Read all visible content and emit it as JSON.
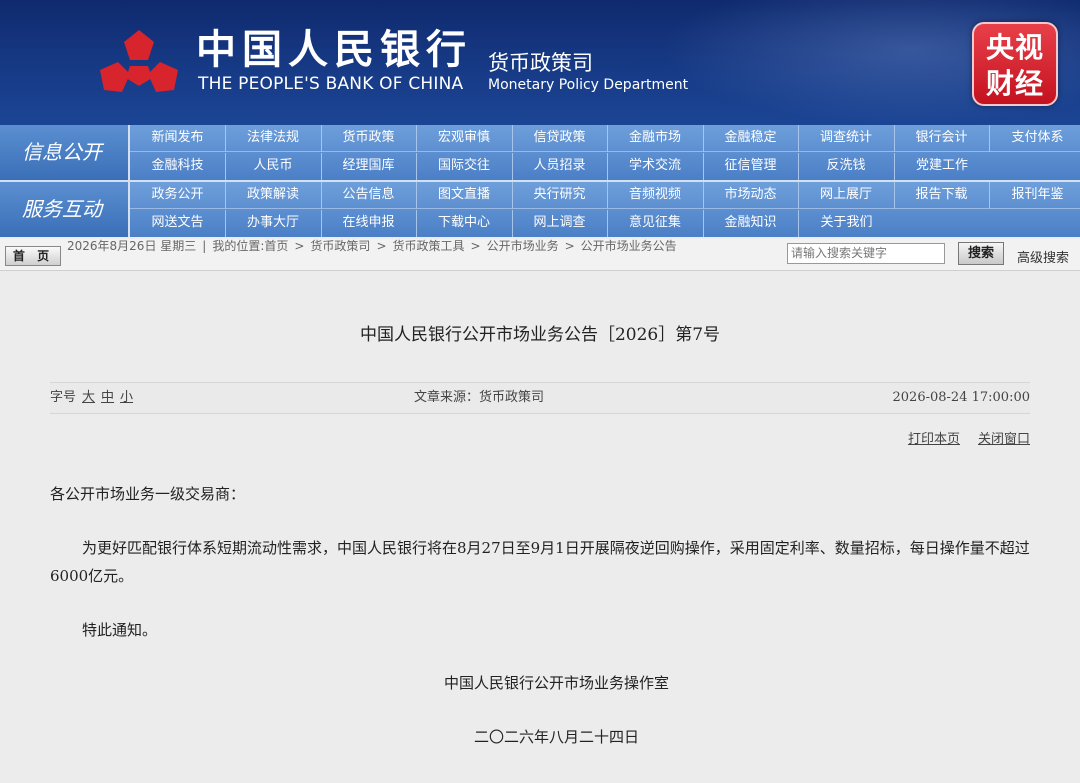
{
  "header": {
    "bank_name_cn": "中国人民银行",
    "bank_name_en": "THE PEOPLE'S BANK OF CHINA",
    "dept_cn": "货币政策司",
    "dept_en": "Monetary Policy Department",
    "logo_icon": "pboc-logo-icon",
    "watermark_line1": "央视",
    "watermark_line2": "财经",
    "colors": {
      "banner": "#173a86",
      "watermark": "#d81e2a"
    }
  },
  "nav": {
    "section1_title": "信息公开",
    "section1_row1": [
      "新闻发布",
      "法律法规",
      "货币政策",
      "宏观审慎",
      "信贷政策",
      "金融市场",
      "金融稳定",
      "调查统计",
      "银行会计",
      "支付体系"
    ],
    "section1_row2": [
      "金融科技",
      "人民币",
      "经理国库",
      "国际交往",
      "人员招录",
      "学术交流",
      "征信管理",
      "反洗钱",
      "党建工作"
    ],
    "section2_title": "服务互动",
    "section2_row1": [
      "政务公开",
      "政策解读",
      "公告信息",
      "图文直播",
      "央行研究",
      "音频视频",
      "市场动态",
      "网上展厅",
      "报告下载",
      "报刊年鉴"
    ],
    "section2_row2": [
      "网送文告",
      "办事大厅",
      "在线申报",
      "下载中心",
      "网上调查",
      "意见征集",
      "金融知识",
      "关于我们"
    ]
  },
  "utility": {
    "home_label": "首 页",
    "date": "2026年8月26日 星期三",
    "location_label": "我的位置:首页",
    "breadcrumb": [
      "货币政策司",
      "货币政策工具",
      "公开市场业务",
      "公开市场业务公告"
    ],
    "search_placeholder": "请输入搜索关键字",
    "search_button": "搜索",
    "advanced_search": "高级搜索"
  },
  "article": {
    "title": "中国人民银行公开市场业务公告［2026］第7号",
    "font_size_label": "字号",
    "font_sizes": [
      "大",
      "中",
      "小"
    ],
    "source": "文章来源：货币政策司",
    "datetime": "2026-08-24 17:00:00",
    "print_label": "打印本页",
    "close_label": "关闭窗口",
    "salutation": "各公开市场业务一级交易商：",
    "body": "为更好匹配银行体系短期流动性需求，中国人民银行将在8月27日至9月1日开展隔夜逆回购操作，采用固定利率、数量招标，每日操作量不超过6000亿元。",
    "notice": "特此通知。",
    "signature": "中国人民银行公开市场业务操作室",
    "sign_date": "二〇二六年八月二十四日"
  }
}
